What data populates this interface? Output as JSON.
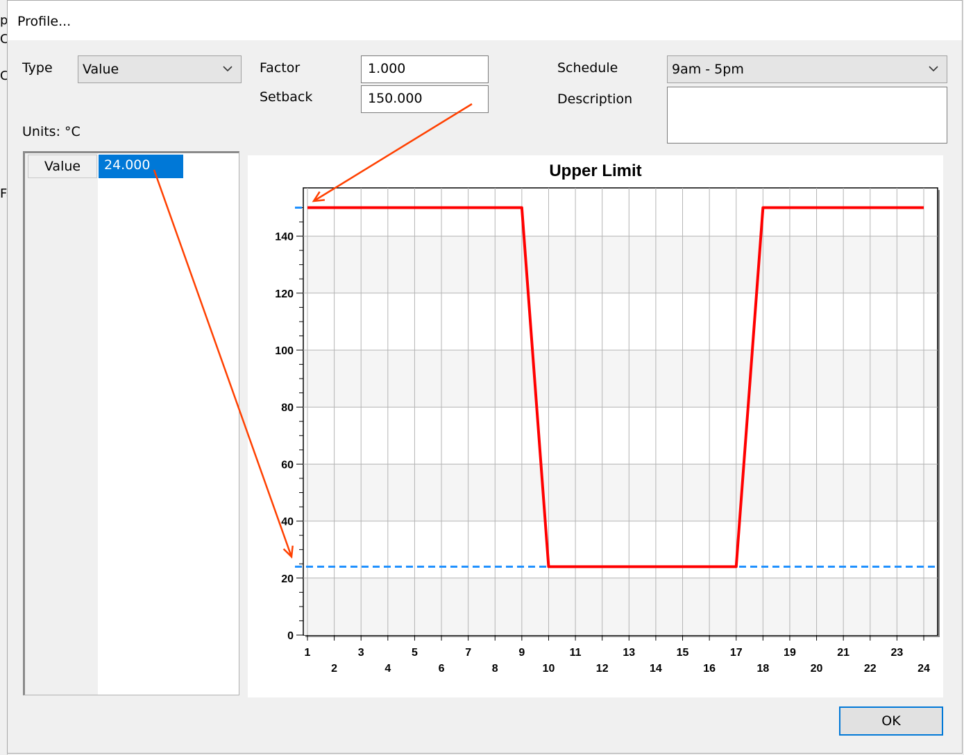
{
  "dialog": {
    "title": "Profile..."
  },
  "type": {
    "label": "Type",
    "value": "Value"
  },
  "factor": {
    "label": "Factor",
    "value": "1.000"
  },
  "setback": {
    "label": "Setback",
    "value": "150.000"
  },
  "schedule": {
    "label": "Schedule",
    "value": "9am - 5pm"
  },
  "description": {
    "label": "Description",
    "value": ""
  },
  "units": "Units: °C",
  "grid": {
    "header": "Value",
    "cell": "24.000"
  },
  "ok_label": "OK",
  "background_fragments": [
    "p",
    "C",
    "C",
    "Fa"
  ],
  "colors": {
    "line": "#ff0000",
    "dashed": "#1e90ff",
    "selection": "#0078d7",
    "annotation": "#ff4000"
  },
  "chart_data": {
    "type": "line",
    "title": "Upper Limit",
    "x": [
      1,
      2,
      3,
      4,
      5,
      6,
      7,
      8,
      9,
      10,
      11,
      12,
      13,
      14,
      15,
      16,
      17,
      18,
      19,
      20,
      21,
      22,
      23,
      24
    ],
    "series": [
      {
        "values": [
          150,
          150,
          150,
          150,
          150,
          150,
          150,
          150,
          150,
          24,
          24,
          24,
          24,
          24,
          24,
          24,
          24,
          150,
          150,
          150,
          150,
          150,
          150,
          150
        ]
      }
    ],
    "reference_lines": [
      150,
      24
    ],
    "ylim": [
      0,
      155
    ],
    "yticks": [
      0,
      20,
      40,
      60,
      80,
      100,
      120,
      140
    ],
    "xlim": [
      1,
      24
    ],
    "grid": true
  }
}
